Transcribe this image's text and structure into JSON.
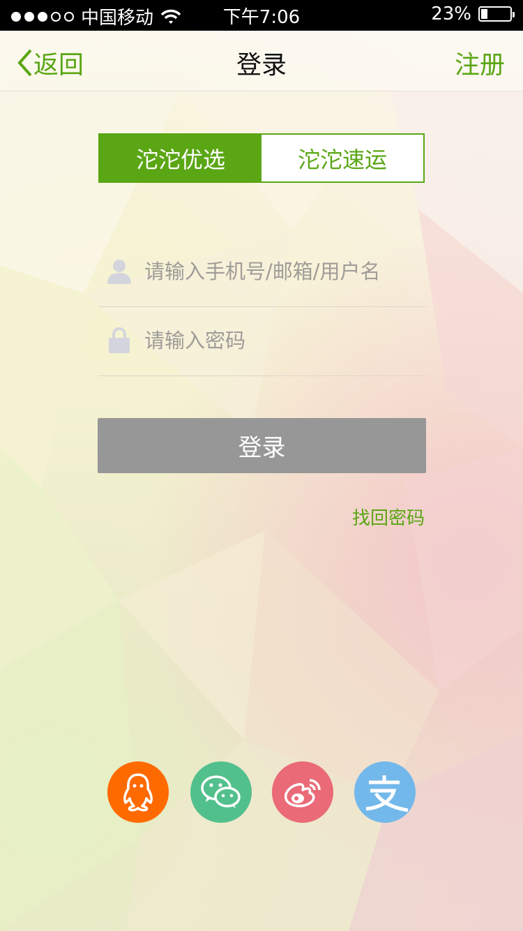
{
  "status_bar": {
    "carrier": "中国移动",
    "time": "下午7:06",
    "battery": "23%",
    "battery_level": 0.23
  },
  "nav": {
    "back_label": "返回",
    "title": "登录",
    "register_label": "注册"
  },
  "tabs": [
    {
      "label": "沱沱优选",
      "active": true
    },
    {
      "label": "沱沱速运",
      "active": false
    }
  ],
  "form": {
    "username_placeholder": "请输入手机号/邮箱/用户名",
    "password_placeholder": "请输入密码",
    "login_label": "登录",
    "forgot_label": "找回密码"
  },
  "social": [
    {
      "icon": "qq-icon",
      "color": "#ff6a00"
    },
    {
      "icon": "wechat-icon",
      "color": "#52c08c"
    },
    {
      "icon": "weibo-icon",
      "color": "#ea6a78"
    },
    {
      "icon": "alipay-icon",
      "color": "#73b8ea"
    }
  ],
  "colors": {
    "accent": "#5aa614",
    "button_disabled": "#979797"
  }
}
